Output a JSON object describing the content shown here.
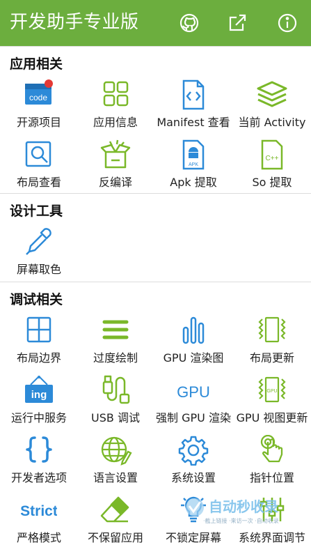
{
  "appbar": {
    "title": "开发助手专业版",
    "actions": [
      "github-icon",
      "share-icon",
      "info-icon"
    ]
  },
  "colors": {
    "primary": "#6cae3e",
    "icon_blue": "#2c8ad8",
    "icon_green": "#7ab829",
    "badge_red": "#e53935"
  },
  "sections": [
    {
      "title": "应用相关",
      "items": [
        {
          "label": "开源项目",
          "icon": "code-icon",
          "badge": true,
          "icon_text": "code"
        },
        {
          "label": "应用信息",
          "icon": "grid-icon"
        },
        {
          "label": "Manifest 查看",
          "icon": "file-code-icon"
        },
        {
          "label": "当前 Activity",
          "icon": "layers-icon"
        },
        {
          "label": "布局查看",
          "icon": "layout-inspect-icon"
        },
        {
          "label": "反编译",
          "icon": "box-icon"
        },
        {
          "label": "Apk 提取",
          "icon": "apk-icon",
          "icon_text": "APK"
        },
        {
          "label": "So 提取",
          "icon": "cpp-file-icon",
          "icon_text": "C++"
        }
      ]
    },
    {
      "title": "设计工具",
      "items": [
        {
          "label": "屏幕取色",
          "icon": "eyedropper-icon"
        }
      ]
    },
    {
      "title": "调试相关",
      "items": [
        {
          "label": "布局边界",
          "icon": "layout-bounds-icon"
        },
        {
          "label": "过度绘制",
          "icon": "overdraw-icon"
        },
        {
          "label": "GPU 渲染图",
          "icon": "gpu-bars-icon"
        },
        {
          "label": "布局更新",
          "icon": "layout-update-icon"
        },
        {
          "label": "运行中服务",
          "icon": "service-sign-icon",
          "icon_text": "ing"
        },
        {
          "label": "USB 调试",
          "icon": "usb-icon"
        },
        {
          "label": "强制 GPU 渲染",
          "icon": "gpu-text-icon",
          "icon_text": "GPU"
        },
        {
          "label": "GPU 视图更新",
          "icon": "gpu-view-icon",
          "icon_text": "GPU"
        },
        {
          "label": "开发者选项",
          "icon": "braces-icon"
        },
        {
          "label": "语言设置",
          "icon": "globe-icon"
        },
        {
          "label": "系统设置",
          "icon": "gear-icon"
        },
        {
          "label": "指针位置",
          "icon": "pointer-hand-icon"
        },
        {
          "label": "严格模式",
          "icon": "strict-icon",
          "icon_text": "Strict"
        },
        {
          "label": "不保留应用",
          "icon": "eraser-icon"
        },
        {
          "label": "不锁定屏幕",
          "icon": "bulb-icon"
        },
        {
          "label": "系统界面调节",
          "icon": "sliders-icon"
        }
      ]
    }
  ],
  "watermark": {
    "main": "自动秒收录",
    "sub": "·截上链接 ·来访一次 ·自动收录"
  }
}
